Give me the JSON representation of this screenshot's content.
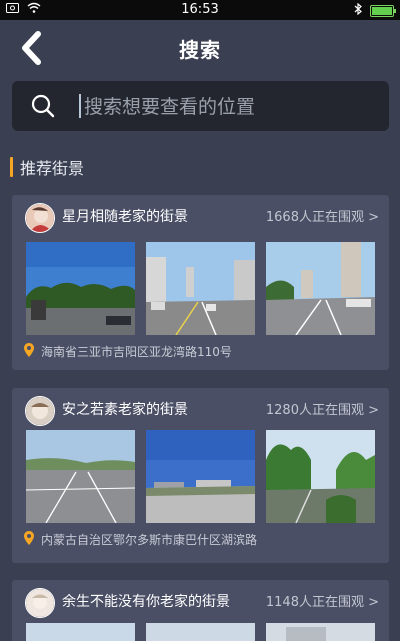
{
  "status_bar": {
    "time": "16:53"
  },
  "header": {
    "title": "搜索"
  },
  "search": {
    "placeholder": "搜索想要查看的位置"
  },
  "section": {
    "title": "推荐街景"
  },
  "cards": [
    {
      "name": "星月相随老家的街景",
      "viewers": "1668人正在围观 >",
      "location": "海南省三亚市吉阳区亚龙湾路110号"
    },
    {
      "name": "安之若素老家的街景",
      "viewers": "1280人正在围观 >",
      "location": "内蒙古自治区鄂尔多斯市康巴什区湖滨路"
    },
    {
      "name": "余生不能没有你老家的街景",
      "viewers": "1148人正在围观 >"
    }
  ],
  "colors": {
    "accent": "#f5a623",
    "background": "#3a3f52",
    "card": "#4a4f65",
    "search_bg": "#23262f"
  }
}
